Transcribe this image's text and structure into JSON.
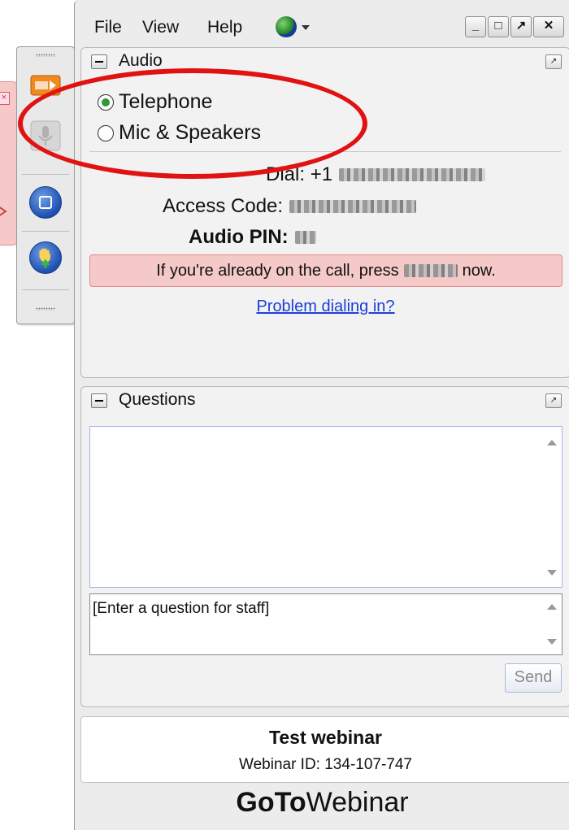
{
  "menu": {
    "file": "File",
    "view": "View",
    "help": "Help"
  },
  "window_buttons": [
    "_",
    "□",
    "↗",
    "✕"
  ],
  "audio": {
    "title": "Audio",
    "options": [
      {
        "label": "Telephone",
        "selected": true
      },
      {
        "label": "Mic & Speakers",
        "selected": false
      }
    ],
    "dial_label": "Dial:",
    "dial_prefix": "+1",
    "access_code_label": "Access Code:",
    "audio_pin_label": "Audio PIN:",
    "notice_before": "If you're already on the call, press",
    "notice_after": "now.",
    "problem_link": "Problem dialing in?"
  },
  "questions": {
    "title": "Questions",
    "input_placeholder": "[Enter a question for staff]",
    "send_label": "Send"
  },
  "webinar": {
    "title": "Test webinar",
    "id_text": "Webinar ID: 134-107-747"
  },
  "brand": {
    "bold": "GoTo",
    "light": "Webinar"
  },
  "colors": {
    "highlight_ellipse": "#e11212",
    "notice_bg": "#f6c9c9",
    "link": "#1b3fd8"
  }
}
